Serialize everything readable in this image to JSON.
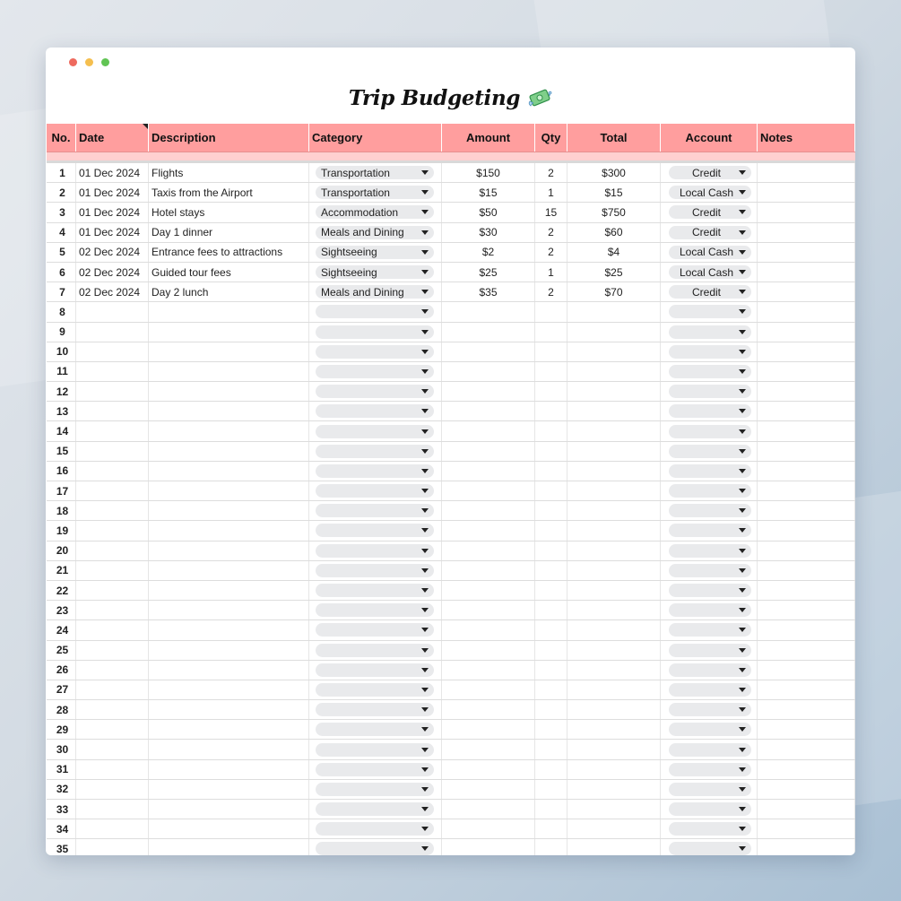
{
  "window": {
    "title": "Trip Budgeting",
    "title_icon": "money-with-wings-icon",
    "traffic_lights": [
      "#ee6a5e",
      "#f5bf4f",
      "#61c454"
    ]
  },
  "columns": [
    "No.",
    "Date",
    "Description",
    "Category",
    "Amount",
    "Qty",
    "Total",
    "Account",
    "Notes"
  ],
  "rows": [
    {
      "no": "1",
      "date": "01 Dec 2024",
      "description": "Flights",
      "category": "Transportation",
      "amount": "$150",
      "qty": "2",
      "total": "$300",
      "account": "Credit",
      "notes": ""
    },
    {
      "no": "2",
      "date": "01 Dec 2024",
      "description": "Taxis from the Airport",
      "category": "Transportation",
      "amount": "$15",
      "qty": "1",
      "total": "$15",
      "account": "Local Cash",
      "notes": ""
    },
    {
      "no": "3",
      "date": "01 Dec 2024",
      "description": "Hotel stays",
      "category": "Accommodation",
      "amount": "$50",
      "qty": "15",
      "total": "$750",
      "account": "Credit",
      "notes": ""
    },
    {
      "no": "4",
      "date": "01 Dec 2024",
      "description": "Day 1 dinner",
      "category": "Meals and Dining",
      "amount": "$30",
      "qty": "2",
      "total": "$60",
      "account": "Credit",
      "notes": ""
    },
    {
      "no": "5",
      "date": "02 Dec 2024",
      "description": "Entrance fees to attractions",
      "category": "Sightseeing",
      "amount": "$2",
      "qty": "2",
      "total": "$4",
      "account": "Local Cash",
      "notes": ""
    },
    {
      "no": "6",
      "date": "02 Dec 2024",
      "description": "Guided tour fees",
      "category": "Sightseeing",
      "amount": "$25",
      "qty": "1",
      "total": "$25",
      "account": "Local Cash",
      "notes": ""
    },
    {
      "no": "7",
      "date": "02 Dec 2024",
      "description": "Day 2 lunch",
      "category": "Meals and Dining",
      "amount": "$35",
      "qty": "2",
      "total": "$70",
      "account": "Credit",
      "notes": ""
    },
    {
      "no": "8",
      "date": "",
      "description": "",
      "category": "",
      "amount": "",
      "qty": "",
      "total": "",
      "account": "",
      "notes": ""
    },
    {
      "no": "9",
      "date": "",
      "description": "",
      "category": "",
      "amount": "",
      "qty": "",
      "total": "",
      "account": "",
      "notes": ""
    },
    {
      "no": "10",
      "date": "",
      "description": "",
      "category": "",
      "amount": "",
      "qty": "",
      "total": "",
      "account": "",
      "notes": ""
    },
    {
      "no": "11",
      "date": "",
      "description": "",
      "category": "",
      "amount": "",
      "qty": "",
      "total": "",
      "account": "",
      "notes": ""
    },
    {
      "no": "12",
      "date": "",
      "description": "",
      "category": "",
      "amount": "",
      "qty": "",
      "total": "",
      "account": "",
      "notes": ""
    },
    {
      "no": "13",
      "date": "",
      "description": "",
      "category": "",
      "amount": "",
      "qty": "",
      "total": "",
      "account": "",
      "notes": ""
    },
    {
      "no": "14",
      "date": "",
      "description": "",
      "category": "",
      "amount": "",
      "qty": "",
      "total": "",
      "account": "",
      "notes": ""
    },
    {
      "no": "15",
      "date": "",
      "description": "",
      "category": "",
      "amount": "",
      "qty": "",
      "total": "",
      "account": "",
      "notes": ""
    },
    {
      "no": "16",
      "date": "",
      "description": "",
      "category": "",
      "amount": "",
      "qty": "",
      "total": "",
      "account": "",
      "notes": ""
    },
    {
      "no": "17",
      "date": "",
      "description": "",
      "category": "",
      "amount": "",
      "qty": "",
      "total": "",
      "account": "",
      "notes": ""
    },
    {
      "no": "18",
      "date": "",
      "description": "",
      "category": "",
      "amount": "",
      "qty": "",
      "total": "",
      "account": "",
      "notes": ""
    },
    {
      "no": "19",
      "date": "",
      "description": "",
      "category": "",
      "amount": "",
      "qty": "",
      "total": "",
      "account": "",
      "notes": ""
    },
    {
      "no": "20",
      "date": "",
      "description": "",
      "category": "",
      "amount": "",
      "qty": "",
      "total": "",
      "account": "",
      "notes": ""
    },
    {
      "no": "21",
      "date": "",
      "description": "",
      "category": "",
      "amount": "",
      "qty": "",
      "total": "",
      "account": "",
      "notes": ""
    },
    {
      "no": "22",
      "date": "",
      "description": "",
      "category": "",
      "amount": "",
      "qty": "",
      "total": "",
      "account": "",
      "notes": ""
    },
    {
      "no": "23",
      "date": "",
      "description": "",
      "category": "",
      "amount": "",
      "qty": "",
      "total": "",
      "account": "",
      "notes": ""
    },
    {
      "no": "24",
      "date": "",
      "description": "",
      "category": "",
      "amount": "",
      "qty": "",
      "total": "",
      "account": "",
      "notes": ""
    },
    {
      "no": "25",
      "date": "",
      "description": "",
      "category": "",
      "amount": "",
      "qty": "",
      "total": "",
      "account": "",
      "notes": ""
    },
    {
      "no": "26",
      "date": "",
      "description": "",
      "category": "",
      "amount": "",
      "qty": "",
      "total": "",
      "account": "",
      "notes": ""
    },
    {
      "no": "27",
      "date": "",
      "description": "",
      "category": "",
      "amount": "",
      "qty": "",
      "total": "",
      "account": "",
      "notes": ""
    },
    {
      "no": "28",
      "date": "",
      "description": "",
      "category": "",
      "amount": "",
      "qty": "",
      "total": "",
      "account": "",
      "notes": ""
    },
    {
      "no": "29",
      "date": "",
      "description": "",
      "category": "",
      "amount": "",
      "qty": "",
      "total": "",
      "account": "",
      "notes": ""
    },
    {
      "no": "30",
      "date": "",
      "description": "",
      "category": "",
      "amount": "",
      "qty": "",
      "total": "",
      "account": "",
      "notes": ""
    },
    {
      "no": "31",
      "date": "",
      "description": "",
      "category": "",
      "amount": "",
      "qty": "",
      "total": "",
      "account": "",
      "notes": ""
    },
    {
      "no": "32",
      "date": "",
      "description": "",
      "category": "",
      "amount": "",
      "qty": "",
      "total": "",
      "account": "",
      "notes": ""
    },
    {
      "no": "33",
      "date": "",
      "description": "",
      "category": "",
      "amount": "",
      "qty": "",
      "total": "",
      "account": "",
      "notes": ""
    },
    {
      "no": "34",
      "date": "",
      "description": "",
      "category": "",
      "amount": "",
      "qty": "",
      "total": "",
      "account": "",
      "notes": ""
    },
    {
      "no": "35",
      "date": "",
      "description": "",
      "category": "",
      "amount": "",
      "qty": "",
      "total": "",
      "account": "",
      "notes": ""
    }
  ],
  "colors": {
    "header_bg": "#ff9e9e",
    "filter_bar": "#ffd0d0",
    "chip_bg": "#e9eaec"
  }
}
